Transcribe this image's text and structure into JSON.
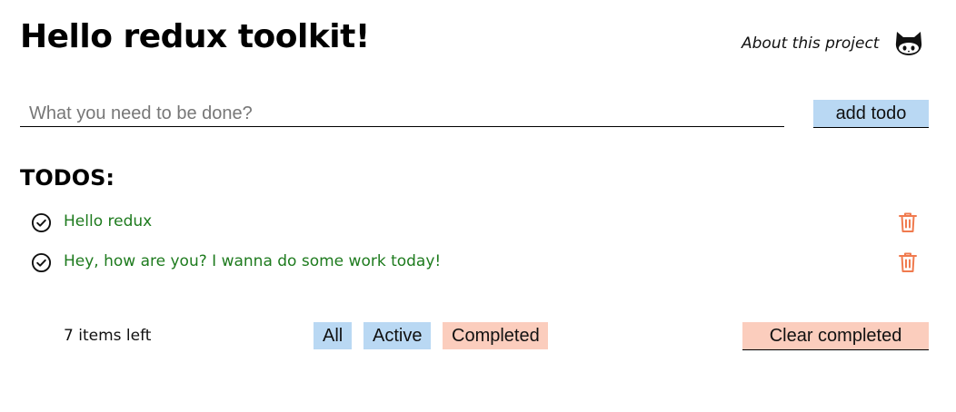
{
  "header": {
    "title": "Hello redux toolkit!",
    "about_link": "About this project",
    "github_icon": "github-octocat-icon"
  },
  "new_todo": {
    "placeholder": "What you need to be done?",
    "value": "",
    "add_label": "add todo"
  },
  "todos": {
    "heading": "TODOS:",
    "items": [
      {
        "text": "Hello redux",
        "status_icon": "check-circle-icon",
        "delete_icon": "trash-icon"
      },
      {
        "text": "Hey, how are you? I wanna do some work today!",
        "status_icon": "check-circle-icon",
        "delete_icon": "trash-icon"
      }
    ]
  },
  "footer": {
    "items_left": "7 items left",
    "filters": {
      "all": "All",
      "active": "Active",
      "completed": "Completed"
    },
    "clear_completed": "Clear completed"
  },
  "colors": {
    "todo_text": "#1e7b1e",
    "delete_icon": "#f07a4e",
    "filter_blue": "#b9d8f3",
    "filter_salmon": "#fbcdbd"
  }
}
